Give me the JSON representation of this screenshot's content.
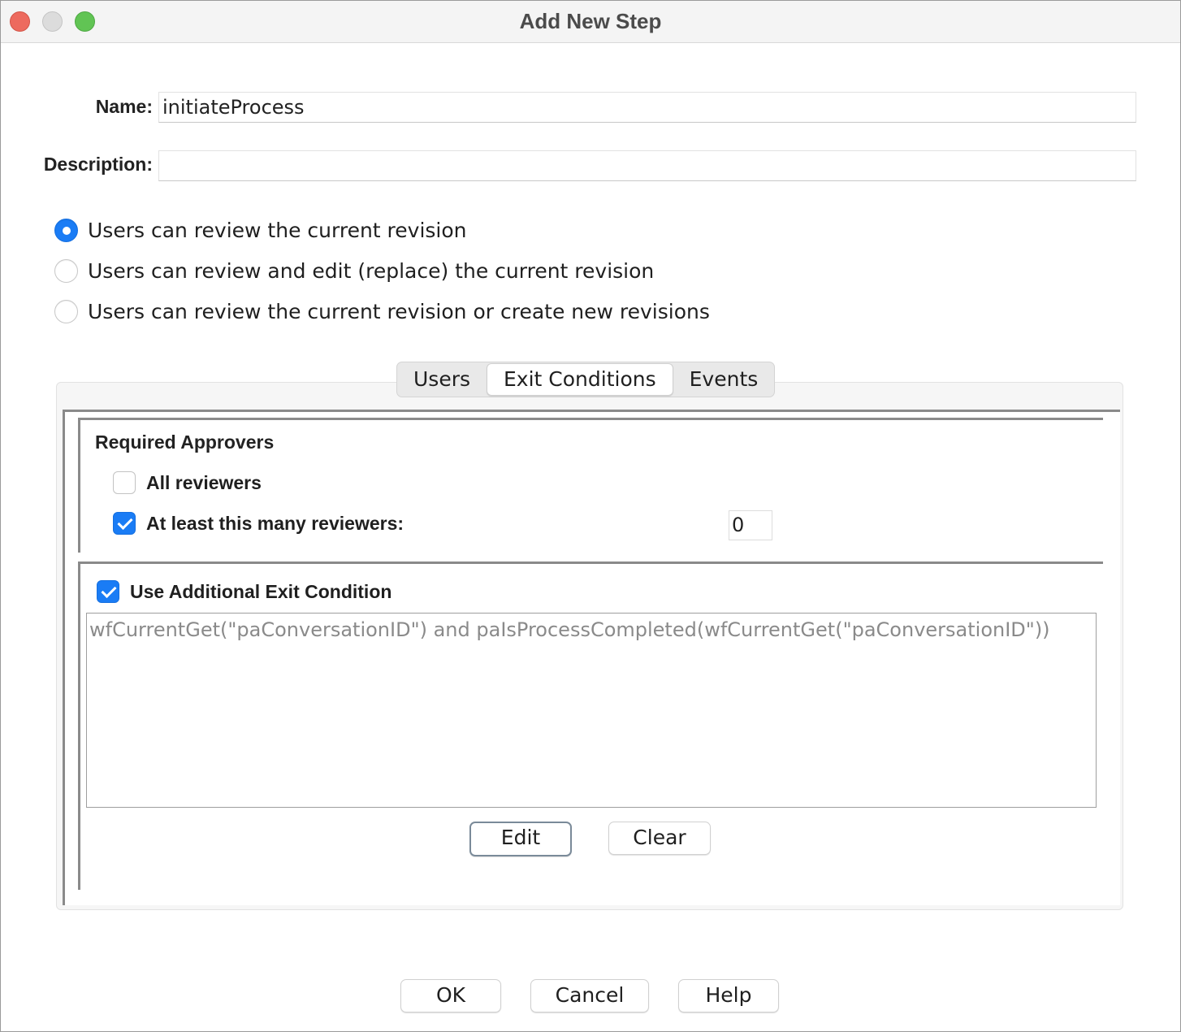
{
  "window": {
    "title": "Add New Step"
  },
  "form": {
    "name_label": "Name:",
    "name_value": "initiateProcess",
    "description_label": "Description:",
    "description_value": ""
  },
  "review_options": [
    {
      "label": "Users can review the current revision",
      "selected": true
    },
    {
      "label": "Users can review and edit (replace) the current revision",
      "selected": false
    },
    {
      "label": "Users can review the current revision or create new revisions",
      "selected": false
    }
  ],
  "tabs": [
    {
      "label": "Users",
      "active": false
    },
    {
      "label": "Exit Conditions",
      "active": true
    },
    {
      "label": "Events",
      "active": false
    }
  ],
  "required_approvers": {
    "title": "Required Approvers",
    "all_reviewers_label": "All reviewers",
    "all_reviewers_checked": false,
    "at_least_label": "At least this many reviewers:",
    "at_least_checked": true,
    "at_least_value": "0"
  },
  "additional_exit": {
    "label": "Use Additional Exit Condition",
    "checked": true,
    "expression": "wfCurrentGet(\"paConversationID\") and paIsProcessCompleted(wfCurrentGet(\"paConversationID\"))",
    "edit_label": "Edit",
    "clear_label": "Clear"
  },
  "footer": {
    "ok_label": "OK",
    "cancel_label": "Cancel",
    "help_label": "Help"
  },
  "colors": {
    "accent": "#1a7cf5",
    "close": "#ed6a5e",
    "maximize": "#61c454"
  }
}
